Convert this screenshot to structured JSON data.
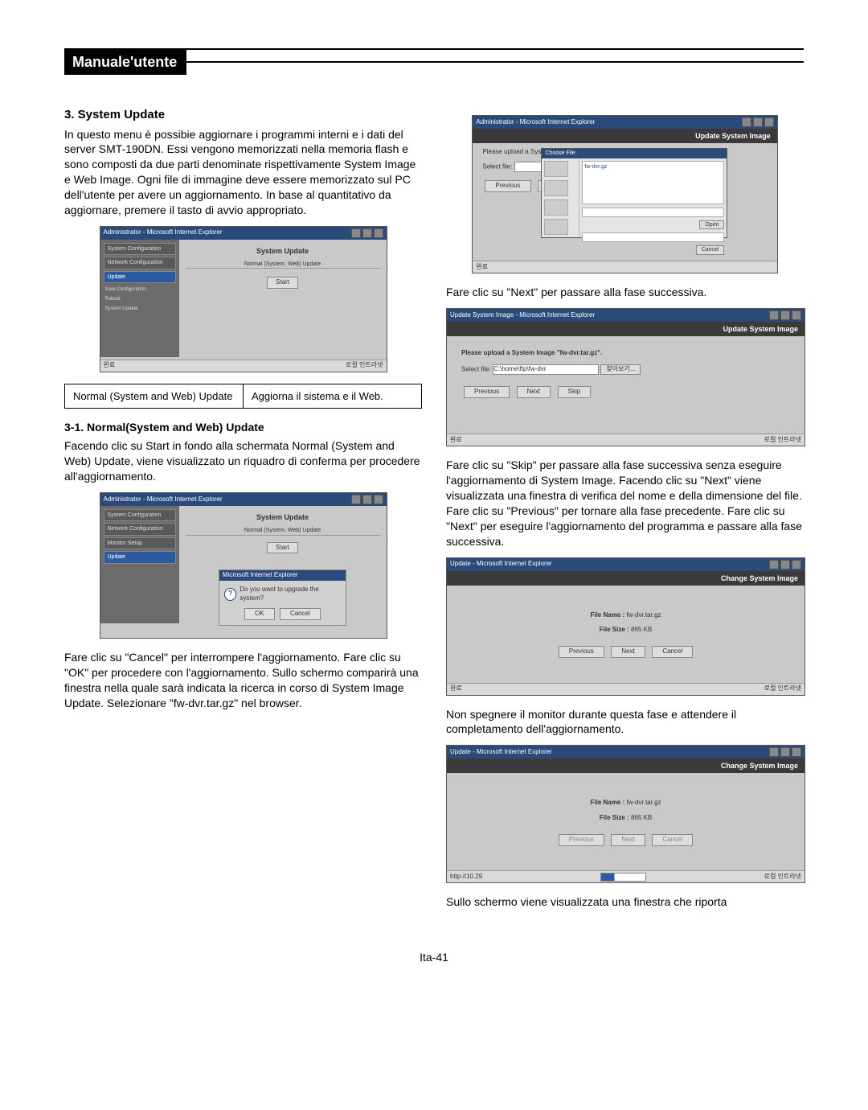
{
  "header": {
    "title": "Manuale'utente"
  },
  "left": {
    "h_system_update": "3. System Update",
    "p_system_update": "In questo menu è possibie aggiornare i programmi interni e i dati del server SMT-190DN. Essi vengono memorizzati nella memoria flash e sono composti da due parti denominate rispettivamente System Image e Web Image. Ogni file di immagine deve essere memorizzato sul PC dell'utente per avere un aggiornamento. In base al quantitativo da aggiornare, premere il tasto di avvio appropriato.",
    "table": {
      "left_cell": "Normal (System and Web) Update",
      "right_cell": "Aggiorna il sistema e il Web."
    },
    "h_normal": "3-1. Normal(System and Web) Update",
    "p_normal": "Facendo clic su Start in fondo alla schermata Normal (System and Web) Update, viene visualizzato un riquadro di conferma per procedere all'aggiornamento.",
    "p_cancel_ok": "Fare clic su \"Cancel\" per interrompere l'aggiornamento. Fare clic su \"OK\" per procedere con l'aggiornamento. Sullo schermo comparirà una finestra nella quale sarà indicata la ricerca in corso di System Image Update. Selezionare \"fw-dvr.tar.gz\" nel browser."
  },
  "right": {
    "p_next1": "Fare clic su \"Next\" per passare alla fase successiva.",
    "p_skip_next_prev": "Fare clic su \"Skip\" per passare alla fase successiva senza eseguire l'aggiornamento di System Image. Facendo clic su \"Next\" viene visualizzata una finestra di verifica del nome e della dimensione del file. Fare clic su \"Previous\" per tornare alla fase precedente. Fare clic su \"Next\" per eseguire l'aggiornamento del programma e passare alla fase successiva.",
    "p_nospegnere": "Non spegnere il monitor durante questa fase e attendere il completamento dell'aggiornamento.",
    "p_final": "Sullo schermo viene visualizzata una finestra che riporta"
  },
  "shots": {
    "admin_title": "Administrator - Microsoft Internet Explorer",
    "sidebar": {
      "sysconf": "System Configuration",
      "netconf": "Network Configuration",
      "monitor": "Monitor Setup",
      "update_sel": "Update",
      "save": "Save Configuration",
      "reboot": "Reboot",
      "sysupd": "System Update"
    },
    "main_heading": "System Update",
    "main_sub": "Normal (System, Web) Update",
    "start_btn": "Start",
    "dlg_title": "Microsoft Internet Explorer",
    "dlg_q": "Do you want to upgrade the system?",
    "ok": "OK",
    "cancel": "Cancel",
    "upload_title": "Update System Image",
    "upload_instr": "Please upload a System Image \"fw-dvr.tar.gz\".",
    "select_file": "Select file:",
    "select_path": "C:\\home\\ftp\\fw-dvr",
    "browse_ko": "찾아보기...",
    "prev": "Previous",
    "next": "Next",
    "skip": "Skip",
    "status_text": "로컬 인트라넷",
    "done": "완료",
    "fd_title": "Choose File",
    "fd_filename": "fw-dvr.gz",
    "fd_open": "Open",
    "fd_cancel": "Cancel",
    "change_title": "Change System Image",
    "file_name_lbl": "File Name :",
    "file_name_val": "fw-dvr.tar.gz",
    "file_size_lbl": "File Size :",
    "file_size_val": "865 KB",
    "url_frag": "http://10.29"
  },
  "footer": {
    "page": "Ita-41"
  }
}
